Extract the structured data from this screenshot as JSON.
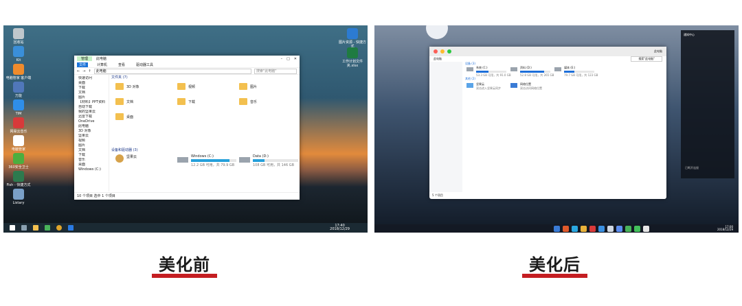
{
  "before": {
    "caption": "美化前",
    "desktop_icons": [
      {
        "label": "回收站",
        "color": "#bfc7cc"
      },
      {
        "label": "Kit",
        "color": "#3a8fd9"
      },
      {
        "label": "电脑管家 客户端",
        "color": "#ef8b2c"
      },
      {
        "label": "万能",
        "color": "#5077ba"
      },
      {
        "label": "TIM",
        "color": "#2f8ee8"
      },
      {
        "label": "网易云音乐",
        "color": "#d83a3a"
      },
      {
        "label": "电脑管家",
        "color": "#ffffff"
      },
      {
        "label": "360安全卫士",
        "color": "#4cae3f"
      },
      {
        "label": "Fish - 快捷方式",
        "color": "#2d7a4e"
      },
      {
        "label": "Listary",
        "color": "#7aa0c8"
      }
    ],
    "right_icons": [
      {
        "label": "图片资源 - 快捷方式",
        "color": "#2c7bd2"
      },
      {
        "label": "工作计划文件夹.xlsx",
        "color": "#1f7b41"
      }
    ],
    "window": {
      "title": "此电脑",
      "manage_tab": "管理",
      "tabs": [
        "文件",
        "计算机",
        "查看",
        "驱动器工具"
      ],
      "address": "此电脑",
      "search_placeholder": "搜索\"此电脑\"",
      "nav_items": [
        "快速访问",
        "桌面",
        "下载",
        "文档",
        "图片",
        "【材料】PPT资料",
        "自动下载",
        "我的坚果云",
        "迅雷下载",
        "OneDrive",
        "此电脑",
        "3D 对象",
        "坚果云",
        "视频",
        "图片",
        "文档",
        "下载",
        "音乐",
        "桌面",
        "Windows (C:)"
      ],
      "folders_header": "文件夹 (7)",
      "folders": [
        "3D 对象",
        "视频",
        "图片",
        "文档",
        "下载",
        "音乐",
        "桌面"
      ],
      "devices_header": "设备和驱动器 (3)",
      "devices": [
        {
          "name": "坚果云",
          "free": ""
        },
        {
          "name": "Windows (C:)",
          "free": "12.2 GB 可用，共 79.9 GB",
          "used_fraction": 0.85
        },
        {
          "name": "Data (D:)",
          "free": "108 GB 可用，共 146 GB",
          "used_fraction": 0.26
        }
      ],
      "status": "10 个项目   选中 1 个项目"
    },
    "taskbar": {
      "time": "17:40",
      "date": "2018/12/29"
    }
  },
  "after": {
    "caption": "美化后",
    "window": {
      "title": "此电脑",
      "address": "此电脑",
      "search_placeholder": "搜索\"此电脑\"",
      "drives_header": "设备 (3)",
      "drives": [
        {
          "name": "系统 (C:)",
          "free": "53.3 GB 可用，共 91.0 GB",
          "used_fraction": 0.41
        },
        {
          "name": "资料 (D:)",
          "free": "52.8 GB 可用，共 265 GB",
          "used_fraction": 0.8
        },
        {
          "name": "媒体 (E:)",
          "free": "79.7 GB 可用，共 123 GB",
          "used_fraction": 0.35
        }
      ],
      "other_header": "其他 (2)",
      "others": [
        {
          "name": "坚果云",
          "desc": "双击进入坚果云同步"
        },
        {
          "name": "网络位置",
          "desc": "双击访问网络位置"
        }
      ],
      "status": "5 个项目"
    },
    "notify_title": "通知中心",
    "notify_footer": "已断开连接",
    "taskbar": {
      "time": "17:00",
      "date": "2018/12/29"
    },
    "dock_colors": [
      "#3a7bd5",
      "#e05a2b",
      "#2aa7e0",
      "#e8b23a",
      "#d93a3a",
      "#3a8fe0",
      "#cfd8e3",
      "#5b8def",
      "#49b35a",
      "#43c05b",
      "#e6e6e6"
    ]
  }
}
